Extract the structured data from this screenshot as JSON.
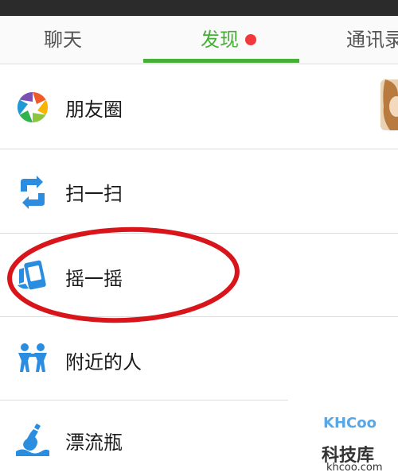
{
  "tabs": [
    {
      "label": "聊天",
      "active": false
    },
    {
      "label": "发现",
      "active": true,
      "badge": true
    },
    {
      "label": "通讯录",
      "active": false
    }
  ],
  "discover": {
    "items": [
      {
        "label": "朋友圈",
        "icon": "moments-aperture-icon"
      },
      {
        "label": "扫一扫",
        "icon": "scan-arrows-icon"
      },
      {
        "label": "摇一摇",
        "icon": "shake-phone-icon"
      },
      {
        "label": "附近的人",
        "icon": "nearby-people-icon"
      },
      {
        "label": "漂流瓶",
        "icon": "drift-bottle-icon"
      }
    ]
  },
  "watermark": {
    "logo_text": "KHCoo",
    "name": "科技库",
    "url": "khcoo.com"
  },
  "colors": {
    "accent": "#45b035",
    "badge": "#f2383b",
    "annotation": "#d8151b",
    "icon_blue": "#2b8de0"
  }
}
